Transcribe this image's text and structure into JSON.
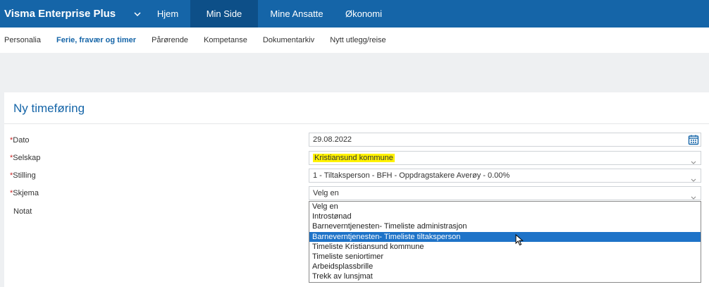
{
  "topbar": {
    "brand": "Visma Enterprise Plus",
    "nav": [
      "Hjem",
      "Min Side",
      "Mine Ansatte",
      "Økonomi"
    ],
    "brand_chevron_icon": "chevron-down-icon"
  },
  "subnav": {
    "items": [
      "Personalia",
      "Ferie, fravær og timer",
      "Pårørende",
      "Kompetanse",
      "Dokumentarkiv",
      "Nytt utlegg/reise"
    ],
    "active": "Ferie, fravær og timer"
  },
  "form": {
    "title": "Ny timeføring",
    "required_marker": "*",
    "dato": {
      "label": "Dato",
      "value": "29.08.2022",
      "icon": "calendar-icon"
    },
    "selskap": {
      "label": "Selskap",
      "value": "Kristiansund kommune"
    },
    "stilling": {
      "label": "Stilling",
      "value": "1 - Tiltaksperson - BFH - Oppdragstakere Averøy - 0.00%"
    },
    "skjema": {
      "label": "Skjema",
      "value": "Velg en"
    },
    "notat": {
      "label": "Notat"
    }
  },
  "dropdown": {
    "options": [
      "Velg en",
      "Introstønad",
      "Barneverntjenesten- Timeliste administrasjon",
      "Barneverntjenesten- Timeliste tiltaksperson",
      "Timeliste Kristiansund kommune",
      "Timeliste seniortimer",
      "Arbeidsplassbrille",
      "Trekk av lunsjmat"
    ],
    "highlighted": "Barneverntjenesten- Timeliste tiltaksperson"
  },
  "colors": {
    "topbar": "#1565a8",
    "topbar_active": "#0d4f88",
    "accent": "#1565a8",
    "highlight": "#fff200",
    "selected_option": "#1e73c8",
    "required": "#c62828"
  }
}
